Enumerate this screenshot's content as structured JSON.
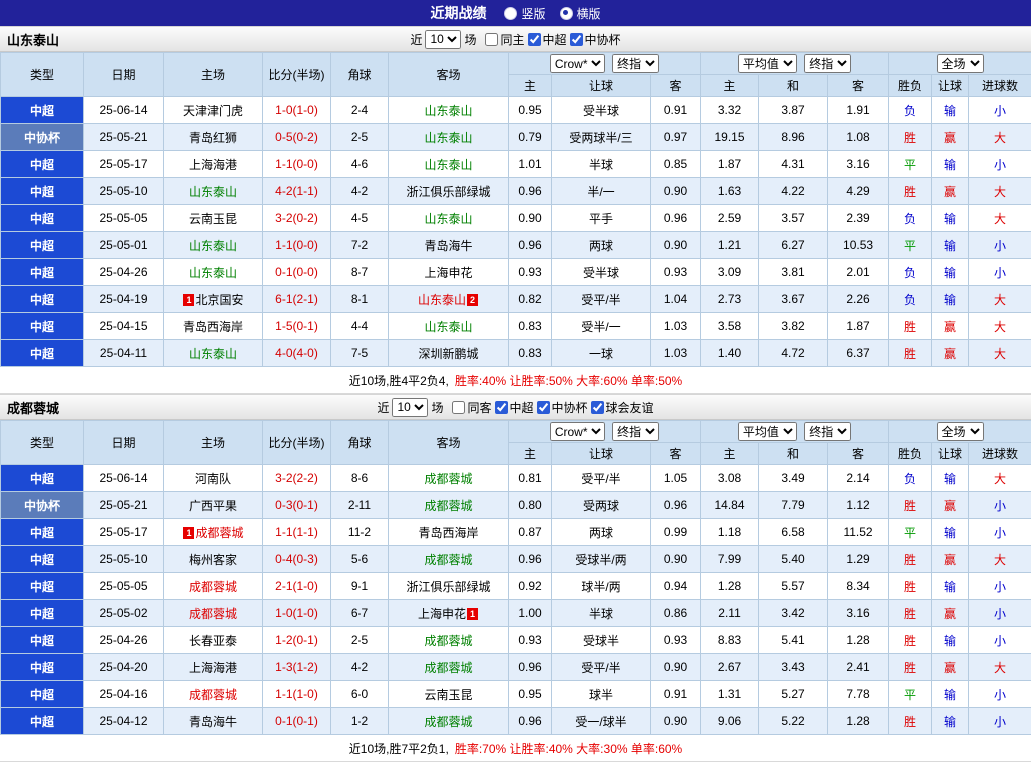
{
  "titlebar": {
    "title": "近期战绩",
    "radios": [
      {
        "label": "竖版",
        "selected": false
      },
      {
        "label": "横版",
        "selected": true
      }
    ]
  },
  "filter_labels": {
    "near": "近",
    "matches_value": "10",
    "unit": "场"
  },
  "header": {
    "type": "类型",
    "date": "日期",
    "home": "主场",
    "score": "比分(半场)",
    "corner": "角球",
    "away": "客场",
    "asia_select": "Crow*",
    "asia_final": "终指",
    "euro_select": "平均值",
    "euro_final": "终指",
    "full_select": "全场",
    "sub": [
      "主",
      "让球",
      "客",
      "主",
      "和",
      "客",
      "胜负",
      "让球",
      "进球数"
    ]
  },
  "colors": {
    "accent_league_super": "#1c4ad4",
    "accent_league_cup": "#5b7cba",
    "team_green": "#008000",
    "team_red": "#dd0000",
    "score_red": "#d40000",
    "result_win": "#dd0000",
    "result_draw": "#009900",
    "result_lose": "#0000cc",
    "titlebar_bg": "#22229a",
    "header_bg": "#cde0f2",
    "zebra_bg": "#e4eefa"
  },
  "sections": [
    {
      "team": "山东泰山",
      "filters": [
        {
          "label": "同主",
          "checked": false
        },
        {
          "label": "中超",
          "checked": true
        },
        {
          "label": "中协杯",
          "checked": true
        }
      ],
      "rows": [
        {
          "league": "中超",
          "league_type": "super",
          "date": "25-06-14",
          "home": {
            "text": "天津津门虎",
            "color": "black"
          },
          "score": "1-0(1-0)",
          "corner": "2-4",
          "away": {
            "text": "山东泰山",
            "color": "green"
          },
          "asia": [
            "0.95",
            "受半球",
            "0.91"
          ],
          "euro": [
            "3.32",
            "3.87",
            "1.91"
          ],
          "results": [
            {
              "text": "负",
              "tone": "lose"
            },
            {
              "text": "输",
              "tone": "lose"
            },
            {
              "text": "小",
              "tone": "lose"
            }
          ]
        },
        {
          "league": "中协杯",
          "league_type": "cup",
          "date": "25-05-21",
          "home": {
            "text": "青岛红狮",
            "color": "black"
          },
          "score": "0-5(0-2)",
          "corner": "2-5",
          "away": {
            "text": "山东泰山",
            "color": "green"
          },
          "asia": [
            "0.79",
            "受两球半/三",
            "0.97"
          ],
          "euro": [
            "19.15",
            "8.96",
            "1.08"
          ],
          "results": [
            {
              "text": "胜",
              "tone": "win"
            },
            {
              "text": "赢",
              "tone": "win"
            },
            {
              "text": "大",
              "tone": "win"
            }
          ]
        },
        {
          "league": "中超",
          "league_type": "super",
          "date": "25-05-17",
          "home": {
            "text": "上海海港",
            "color": "black"
          },
          "score": "1-1(0-0)",
          "corner": "4-6",
          "away": {
            "text": "山东泰山",
            "color": "green"
          },
          "asia": [
            "1.01",
            "半球",
            "0.85"
          ],
          "euro": [
            "1.87",
            "4.31",
            "3.16"
          ],
          "results": [
            {
              "text": "平",
              "tone": "draw"
            },
            {
              "text": "输",
              "tone": "lose"
            },
            {
              "text": "小",
              "tone": "lose"
            }
          ]
        },
        {
          "league": "中超",
          "league_type": "super",
          "date": "25-05-10",
          "home": {
            "text": "山东泰山",
            "color": "green"
          },
          "score": "4-2(1-1)",
          "corner": "4-2",
          "away": {
            "text": "浙江俱乐部绿城",
            "color": "black"
          },
          "asia": [
            "0.96",
            "半/一",
            "0.90"
          ],
          "euro": [
            "1.63",
            "4.22",
            "4.29"
          ],
          "results": [
            {
              "text": "胜",
              "tone": "win"
            },
            {
              "text": "赢",
              "tone": "win"
            },
            {
              "text": "大",
              "tone": "win"
            }
          ]
        },
        {
          "league": "中超",
          "league_type": "super",
          "date": "25-05-05",
          "home": {
            "text": "云南玉昆",
            "color": "black"
          },
          "score": "3-2(0-2)",
          "corner": "4-5",
          "away": {
            "text": "山东泰山",
            "color": "green"
          },
          "asia": [
            "0.90",
            "平手",
            "0.96"
          ],
          "euro": [
            "2.59",
            "3.57",
            "2.39"
          ],
          "results": [
            {
              "text": "负",
              "tone": "lose"
            },
            {
              "text": "输",
              "tone": "lose"
            },
            {
              "text": "大",
              "tone": "win"
            }
          ]
        },
        {
          "league": "中超",
          "league_type": "super",
          "date": "25-05-01",
          "home": {
            "text": "山东泰山",
            "color": "green"
          },
          "score": "1-1(0-0)",
          "corner": "7-2",
          "away": {
            "text": "青岛海牛",
            "color": "black"
          },
          "asia": [
            "0.96",
            "两球",
            "0.90"
          ],
          "euro": [
            "1.21",
            "6.27",
            "10.53"
          ],
          "results": [
            {
              "text": "平",
              "tone": "draw"
            },
            {
              "text": "输",
              "tone": "lose"
            },
            {
              "text": "小",
              "tone": "lose"
            }
          ]
        },
        {
          "league": "中超",
          "league_type": "super",
          "date": "25-04-26",
          "home": {
            "text": "山东泰山",
            "color": "green"
          },
          "score": "0-1(0-0)",
          "corner": "8-7",
          "away": {
            "text": "上海申花",
            "color": "black"
          },
          "asia": [
            "0.93",
            "受半球",
            "0.93"
          ],
          "euro": [
            "3.09",
            "3.81",
            "2.01"
          ],
          "results": [
            {
              "text": "负",
              "tone": "lose"
            },
            {
              "text": "输",
              "tone": "lose"
            },
            {
              "text": "小",
              "tone": "lose"
            }
          ]
        },
        {
          "league": "中超",
          "league_type": "super",
          "date": "25-04-19",
          "home": {
            "text": "北京国安",
            "color": "black",
            "badge_before": "1"
          },
          "score": "6-1(2-1)",
          "corner": "8-1",
          "away": {
            "text": "山东泰山",
            "color": "red",
            "badge_after": "2"
          },
          "asia": [
            "0.82",
            "受平/半",
            "1.04"
          ],
          "euro": [
            "2.73",
            "3.67",
            "2.26"
          ],
          "results": [
            {
              "text": "负",
              "tone": "lose"
            },
            {
              "text": "输",
              "tone": "lose"
            },
            {
              "text": "大",
              "tone": "win"
            }
          ]
        },
        {
          "league": "中超",
          "league_type": "super",
          "date": "25-04-15",
          "home": {
            "text": "青岛西海岸",
            "color": "black"
          },
          "score": "1-5(0-1)",
          "corner": "4-4",
          "away": {
            "text": "山东泰山",
            "color": "green"
          },
          "asia": [
            "0.83",
            "受半/一",
            "1.03"
          ],
          "euro": [
            "3.58",
            "3.82",
            "1.87"
          ],
          "results": [
            {
              "text": "胜",
              "tone": "win"
            },
            {
              "text": "赢",
              "tone": "win"
            },
            {
              "text": "大",
              "tone": "win"
            }
          ]
        },
        {
          "league": "中超",
          "league_type": "super",
          "date": "25-04-11",
          "home": {
            "text": "山东泰山",
            "color": "green"
          },
          "score": "4-0(4-0)",
          "corner": "7-5",
          "away": {
            "text": "深圳新鹏城",
            "color": "black"
          },
          "asia": [
            "0.83",
            "一球",
            "1.03"
          ],
          "euro": [
            "1.40",
            "4.72",
            "6.37"
          ],
          "results": [
            {
              "text": "胜",
              "tone": "win"
            },
            {
              "text": "赢",
              "tone": "win"
            },
            {
              "text": "大",
              "tone": "win"
            }
          ]
        }
      ],
      "summary_plain": "近10场,胜4平2负4,",
      "summary_red": "胜率:40% 让胜率:50% 大率:60% 单率:50%"
    },
    {
      "team": "成都蓉城",
      "filters": [
        {
          "label": "同客",
          "checked": false
        },
        {
          "label": "中超",
          "checked": true
        },
        {
          "label": "中协杯",
          "checked": true
        },
        {
          "label": "球会友谊",
          "checked": true
        }
      ],
      "rows": [
        {
          "league": "中超",
          "league_type": "super",
          "date": "25-06-14",
          "home": {
            "text": "河南队",
            "color": "black"
          },
          "score": "3-2(2-2)",
          "corner": "8-6",
          "away": {
            "text": "成都蓉城",
            "color": "green"
          },
          "asia": [
            "0.81",
            "受平/半",
            "1.05"
          ],
          "euro": [
            "3.08",
            "3.49",
            "2.14"
          ],
          "results": [
            {
              "text": "负",
              "tone": "lose"
            },
            {
              "text": "输",
              "tone": "lose"
            },
            {
              "text": "大",
              "tone": "win"
            }
          ]
        },
        {
          "league": "中协杯",
          "league_type": "cup",
          "date": "25-05-21",
          "home": {
            "text": "广西平果",
            "color": "black"
          },
          "score": "0-3(0-1)",
          "corner": "2-11",
          "away": {
            "text": "成都蓉城",
            "color": "green"
          },
          "asia": [
            "0.80",
            "受两球",
            "0.96"
          ],
          "euro": [
            "14.84",
            "7.79",
            "1.12"
          ],
          "results": [
            {
              "text": "胜",
              "tone": "win"
            },
            {
              "text": "赢",
              "tone": "win"
            },
            {
              "text": "小",
              "tone": "lose"
            }
          ]
        },
        {
          "league": "中超",
          "league_type": "super",
          "date": "25-05-17",
          "home": {
            "text": "成都蓉城",
            "color": "red",
            "badge_before": "1"
          },
          "score": "1-1(1-1)",
          "corner": "11-2",
          "away": {
            "text": "青岛西海岸",
            "color": "black"
          },
          "asia": [
            "0.87",
            "两球",
            "0.99"
          ],
          "euro": [
            "1.18",
            "6.58",
            "11.52"
          ],
          "results": [
            {
              "text": "平",
              "tone": "draw"
            },
            {
              "text": "输",
              "tone": "lose"
            },
            {
              "text": "小",
              "tone": "lose"
            }
          ]
        },
        {
          "league": "中超",
          "league_type": "super",
          "date": "25-05-10",
          "home": {
            "text": "梅州客家",
            "color": "black"
          },
          "score": "0-4(0-3)",
          "corner": "5-6",
          "away": {
            "text": "成都蓉城",
            "color": "green"
          },
          "asia": [
            "0.96",
            "受球半/两",
            "0.90"
          ],
          "euro": [
            "7.99",
            "5.40",
            "1.29"
          ],
          "results": [
            {
              "text": "胜",
              "tone": "win"
            },
            {
              "text": "赢",
              "tone": "win"
            },
            {
              "text": "大",
              "tone": "win"
            }
          ]
        },
        {
          "league": "中超",
          "league_type": "super",
          "date": "25-05-05",
          "home": {
            "text": "成都蓉城",
            "color": "red"
          },
          "score": "2-1(1-0)",
          "corner": "9-1",
          "away": {
            "text": "浙江俱乐部绿城",
            "color": "black"
          },
          "asia": [
            "0.92",
            "球半/两",
            "0.94"
          ],
          "euro": [
            "1.28",
            "5.57",
            "8.34"
          ],
          "results": [
            {
              "text": "胜",
              "tone": "win"
            },
            {
              "text": "输",
              "tone": "lose"
            },
            {
              "text": "小",
              "tone": "lose"
            }
          ]
        },
        {
          "league": "中超",
          "league_type": "super",
          "date": "25-05-02",
          "home": {
            "text": "成都蓉城",
            "color": "red"
          },
          "score": "1-0(1-0)",
          "corner": "6-7",
          "away": {
            "text": "上海申花",
            "color": "black",
            "badge_after": "1"
          },
          "asia": [
            "1.00",
            "半球",
            "0.86"
          ],
          "euro": [
            "2.11",
            "3.42",
            "3.16"
          ],
          "results": [
            {
              "text": "胜",
              "tone": "win"
            },
            {
              "text": "赢",
              "tone": "win"
            },
            {
              "text": "小",
              "tone": "lose"
            }
          ]
        },
        {
          "league": "中超",
          "league_type": "super",
          "date": "25-04-26",
          "home": {
            "text": "长春亚泰",
            "color": "black"
          },
          "score": "1-2(0-1)",
          "corner": "2-5",
          "away": {
            "text": "成都蓉城",
            "color": "green"
          },
          "asia": [
            "0.93",
            "受球半",
            "0.93"
          ],
          "euro": [
            "8.83",
            "5.41",
            "1.28"
          ],
          "results": [
            {
              "text": "胜",
              "tone": "win"
            },
            {
              "text": "输",
              "tone": "lose"
            },
            {
              "text": "小",
              "tone": "lose"
            }
          ]
        },
        {
          "league": "中超",
          "league_type": "super",
          "date": "25-04-20",
          "home": {
            "text": "上海海港",
            "color": "black"
          },
          "score": "1-3(1-2)",
          "corner": "4-2",
          "away": {
            "text": "成都蓉城",
            "color": "green"
          },
          "asia": [
            "0.96",
            "受平/半",
            "0.90"
          ],
          "euro": [
            "2.67",
            "3.43",
            "2.41"
          ],
          "results": [
            {
              "text": "胜",
              "tone": "win"
            },
            {
              "text": "赢",
              "tone": "win"
            },
            {
              "text": "大",
              "tone": "win"
            }
          ]
        },
        {
          "league": "中超",
          "league_type": "super",
          "date": "25-04-16",
          "home": {
            "text": "成都蓉城",
            "color": "red"
          },
          "score": "1-1(1-0)",
          "corner": "6-0",
          "away": {
            "text": "云南玉昆",
            "color": "black"
          },
          "asia": [
            "0.95",
            "球半",
            "0.91"
          ],
          "euro": [
            "1.31",
            "5.27",
            "7.78"
          ],
          "results": [
            {
              "text": "平",
              "tone": "draw"
            },
            {
              "text": "输",
              "tone": "lose"
            },
            {
              "text": "小",
              "tone": "lose"
            }
          ]
        },
        {
          "league": "中超",
          "league_type": "super",
          "date": "25-04-12",
          "home": {
            "text": "青岛海牛",
            "color": "black"
          },
          "score": "0-1(0-1)",
          "corner": "1-2",
          "away": {
            "text": "成都蓉城",
            "color": "green"
          },
          "asia": [
            "0.96",
            "受一/球半",
            "0.90"
          ],
          "euro": [
            "9.06",
            "5.22",
            "1.28"
          ],
          "results": [
            {
              "text": "胜",
              "tone": "win"
            },
            {
              "text": "输",
              "tone": "lose"
            },
            {
              "text": "小",
              "tone": "lose"
            }
          ]
        }
      ],
      "summary_plain": "近10场,胜7平2负1,",
      "summary_red": "胜率:70% 让胜率:40% 大率:30% 单率:60%"
    }
  ]
}
